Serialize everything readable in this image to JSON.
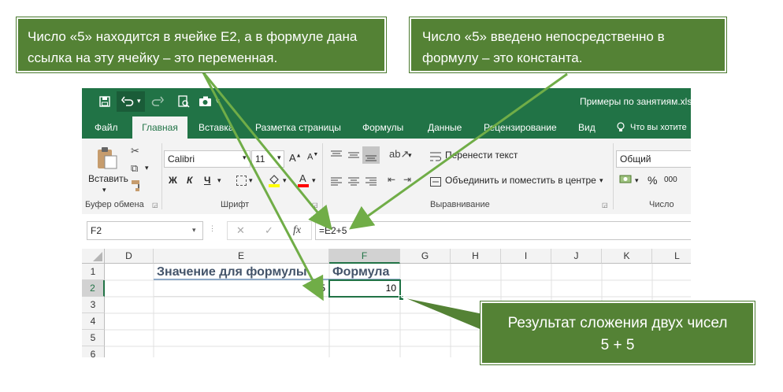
{
  "colors": {
    "excel_green": "#217346",
    "callout_green": "#548235",
    "header_text_blue": "#44546a"
  },
  "titlebar": {
    "filename": "Примеры по занятиям.xls",
    "save_icon": "save-icon",
    "undo_icon": "undo-icon",
    "redo_icon": "redo-icon",
    "print_preview_icon": "print-preview-icon",
    "camera_icon": "camera-icon"
  },
  "tabs": [
    {
      "label": "Файл"
    },
    {
      "label": "Главная"
    },
    {
      "label": "Вставка"
    },
    {
      "label": "Разметка страницы"
    },
    {
      "label": "Формулы"
    },
    {
      "label": "Данные"
    },
    {
      "label": "Рецензирование"
    },
    {
      "label": "Вид"
    },
    {
      "label": "Что вы хотите"
    }
  ],
  "ribbon": {
    "paste_label": "Вставить",
    "clipboard_group": "Буфер обмена",
    "font_name": "Calibri",
    "font_size": "11",
    "bold": "Ж",
    "italic": "К",
    "underline": "Ч",
    "font_group": "Шрифт",
    "wrap_text": "Перенести текст",
    "merge_center": "Объединить и поместить в центре",
    "alignment_group": "Выравнивание",
    "number_format": "Общий",
    "percent": "%",
    "thousands": "000",
    "number_group": "Число"
  },
  "formula_bar": {
    "name_box": "F2",
    "fx_label": "fx",
    "formula": "=E2+5"
  },
  "grid": {
    "columns": [
      "D",
      "E",
      "F",
      "G",
      "H",
      "I",
      "J",
      "K",
      "L"
    ],
    "rows": [
      "1",
      "2",
      "3",
      "4",
      "5",
      "6"
    ],
    "E1": "Значение для формулы",
    "F1": "Формула",
    "E2": "5",
    "F2": "10"
  },
  "callouts": {
    "variable": "Число «5» находится в ячейке E2, а в формуле дана ссылка на эту ячейку – это переменная.",
    "constant": "Число «5» введено непосредственно в формулу – это константа.",
    "result_line1": "Результат сложения двух чисел",
    "result_line2": "5 + 5"
  }
}
